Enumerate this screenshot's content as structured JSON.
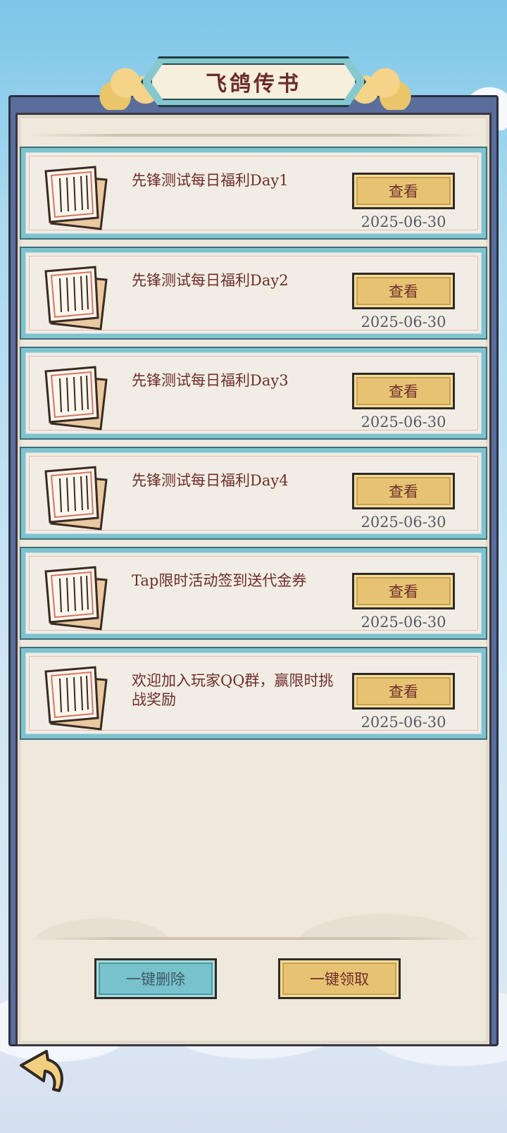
{
  "header": {
    "title": "飞鸽传书"
  },
  "mails": [
    {
      "title": "先锋测试每日福利Day1",
      "button": "查看",
      "date": "2025-06-30"
    },
    {
      "title": "先锋测试每日福利Day2",
      "button": "查看",
      "date": "2025-06-30"
    },
    {
      "title": "先锋测试每日福利Day3",
      "button": "查看",
      "date": "2025-06-30"
    },
    {
      "title": "先锋测试每日福利Day4",
      "button": "查看",
      "date": "2025-06-30"
    },
    {
      "title": "Tap限时活动签到送代金券",
      "button": "查看",
      "date": "2025-06-30"
    },
    {
      "title": "欢迎加入玩家QQ群，赢限时挑战奖励",
      "button": "查看",
      "date": "2025-06-30"
    }
  ],
  "actions": {
    "delete_all": "一键删除",
    "collect_all": "一键领取"
  },
  "icons": {
    "letter": "letter-scroll-icon",
    "back": "back-arrow-icon"
  },
  "colors": {
    "teal": "#7fc3cf",
    "gold": "#e6c372",
    "text": "#6e2c2c",
    "date": "#575b66"
  }
}
